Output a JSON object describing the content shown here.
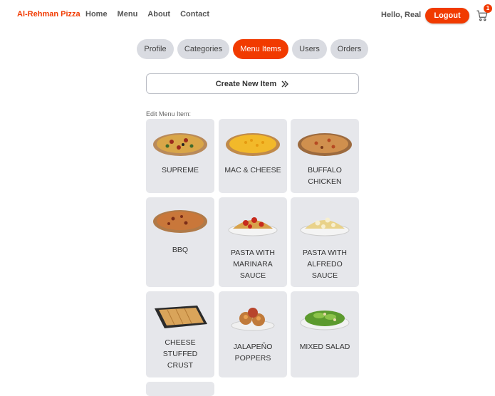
{
  "header": {
    "brand": "Al-Rehman Pizza",
    "nav": [
      "Home",
      "Menu",
      "About",
      "Contact"
    ],
    "greeting": "Hello, Real",
    "logout_label": "Logout",
    "cart_count": "1"
  },
  "tabs": [
    {
      "label": "Profile",
      "active": false
    },
    {
      "label": "Categories",
      "active": false
    },
    {
      "label": "Menu Items",
      "active": true
    },
    {
      "label": "Users",
      "active": false
    },
    {
      "label": "Orders",
      "active": false
    }
  ],
  "create_label": "Create New Item",
  "edit_label": "Edit Menu Item:",
  "menu_items": [
    {
      "name": "SUPREME",
      "icon": "pizza-supreme-icon"
    },
    {
      "name": "MAC & CHEESE",
      "icon": "pizza-mac-cheese-icon"
    },
    {
      "name": "BUFFALO\nCHICKEN",
      "icon": "pizza-buffalo-icon"
    },
    {
      "name": "BBQ",
      "icon": "pizza-bbq-icon"
    },
    {
      "name": "PASTA WITH\nMARINARA\nSAUCE",
      "icon": "pasta-marinara-icon"
    },
    {
      "name": "PASTA WITH\nALFREDO\nSAUCE",
      "icon": "pasta-alfredo-icon"
    },
    {
      "name": "CHEESE\nSTUFFED\nCRUST",
      "icon": "breadsticks-icon"
    },
    {
      "name": "JALAPEÑO\nPOPPERS",
      "icon": "poppers-icon"
    },
    {
      "name": "MIXED SALAD",
      "icon": "salad-icon"
    }
  ],
  "colors": {
    "accent": "#f13a00",
    "tab_bg": "#d9dbe1",
    "card_bg": "#e6e7eb"
  }
}
